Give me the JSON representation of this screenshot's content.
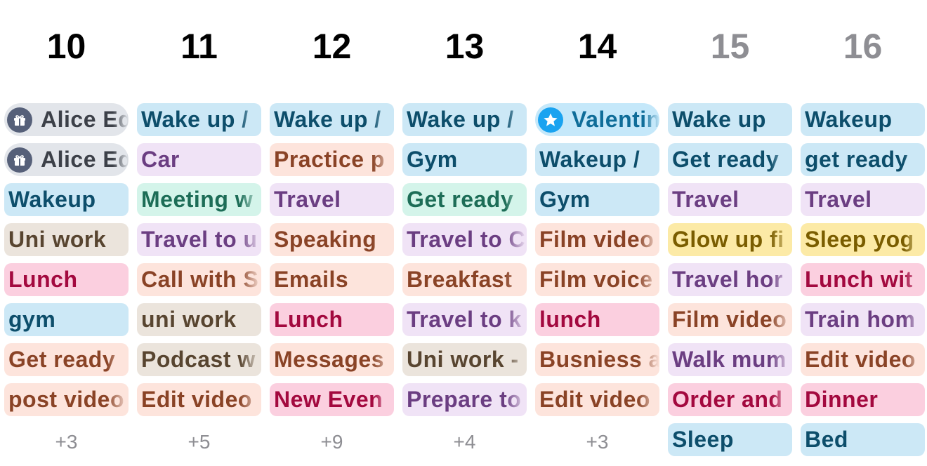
{
  "colors": {
    "blue": "#cce8f6",
    "purple": "#f0e3f6",
    "peach": "#fde4dc",
    "pink": "#fbcfdf",
    "beige": "#ebe4dc",
    "mint": "#d4f4ea",
    "yellow": "#fceaa6",
    "gray": "#e2e5ea",
    "today_star": "#1aa3f0"
  },
  "days": [
    {
      "number": "10",
      "weekend": false,
      "more": "+3",
      "events": [
        {
          "label": "Alice Ed",
          "color": "gray",
          "icon": "gift-icon"
        },
        {
          "label": "Alice Ed",
          "color": "gray",
          "icon": "gift-icon"
        },
        {
          "label": "Wakeup",
          "color": "blue"
        },
        {
          "label": "Uni work",
          "color": "beige"
        },
        {
          "label": "Lunch",
          "color": "pink"
        },
        {
          "label": "gym",
          "color": "blue"
        },
        {
          "label": "Get ready",
          "color": "peach"
        },
        {
          "label": "post video",
          "color": "peach"
        }
      ]
    },
    {
      "number": "11",
      "weekend": false,
      "more": "+5",
      "events": [
        {
          "label": "Wake up / ",
          "color": "blue"
        },
        {
          "label": "Car",
          "color": "purple"
        },
        {
          "label": "Meeting w",
          "color": "mint"
        },
        {
          "label": "Travel to u",
          "color": "purple"
        },
        {
          "label": "Call with S",
          "color": "peach"
        },
        {
          "label": "uni work",
          "color": "beige"
        },
        {
          "label": "Podcast w",
          "color": "beige"
        },
        {
          "label": "Edit video",
          "color": "peach"
        }
      ]
    },
    {
      "number": "12",
      "weekend": false,
      "more": "+9",
      "events": [
        {
          "label": "Wake up / ",
          "color": "blue"
        },
        {
          "label": "Practice p",
          "color": "peach"
        },
        {
          "label": "Travel",
          "color": "purple"
        },
        {
          "label": "Speaking ",
          "color": "peach"
        },
        {
          "label": "Emails",
          "color": "peach"
        },
        {
          "label": "Lunch",
          "color": "pink"
        },
        {
          "label": "Messages",
          "color": "peach"
        },
        {
          "label": "New Even",
          "color": "pink"
        }
      ]
    },
    {
      "number": "13",
      "weekend": false,
      "more": "+4",
      "events": [
        {
          "label": "Wake up / ",
          "color": "blue"
        },
        {
          "label": "Gym",
          "color": "blue"
        },
        {
          "label": "Get ready",
          "color": "mint"
        },
        {
          "label": "Travel to C",
          "color": "purple"
        },
        {
          "label": "Breakfast",
          "color": "peach"
        },
        {
          "label": "Travel to k",
          "color": "purple"
        },
        {
          "label": "Uni work -",
          "color": "beige"
        },
        {
          "label": "Prepare to",
          "color": "purple"
        }
      ]
    },
    {
      "number": "14",
      "weekend": false,
      "more": "+3",
      "events": [
        {
          "label": "Valentin",
          "color": "star",
          "icon": "star-icon"
        },
        {
          "label": "Wakeup / ",
          "color": "blue"
        },
        {
          "label": "Gym",
          "color": "blue"
        },
        {
          "label": "Film video",
          "color": "peach"
        },
        {
          "label": "Film voice",
          "color": "peach"
        },
        {
          "label": "lunch",
          "color": "pink"
        },
        {
          "label": "Busniess a",
          "color": "peach"
        },
        {
          "label": "Edit video",
          "color": "peach"
        }
      ]
    },
    {
      "number": "15",
      "weekend": true,
      "more": "",
      "events": [
        {
          "label": "Wake up",
          "color": "blue"
        },
        {
          "label": "Get ready",
          "color": "blue"
        },
        {
          "label": "Travel",
          "color": "purple"
        },
        {
          "label": "Glow up fi",
          "color": "yellow"
        },
        {
          "label": "Travel hor",
          "color": "purple"
        },
        {
          "label": "Film video",
          "color": "peach"
        },
        {
          "label": "Walk mum",
          "color": "purple"
        },
        {
          "label": "Order and",
          "color": "pink"
        },
        {
          "label": "Sleep",
          "color": "blue"
        }
      ]
    },
    {
      "number": "16",
      "weekend": true,
      "more": "",
      "events": [
        {
          "label": "Wakeup",
          "color": "blue"
        },
        {
          "label": "get ready",
          "color": "blue"
        },
        {
          "label": "Travel",
          "color": "purple"
        },
        {
          "label": "Sleep yog",
          "color": "yellow"
        },
        {
          "label": "Lunch wit",
          "color": "pink"
        },
        {
          "label": "Train hom",
          "color": "purple"
        },
        {
          "label": "Edit video",
          "color": "peach"
        },
        {
          "label": "Dinner",
          "color": "pink"
        },
        {
          "label": "Bed",
          "color": "blue"
        }
      ]
    }
  ]
}
